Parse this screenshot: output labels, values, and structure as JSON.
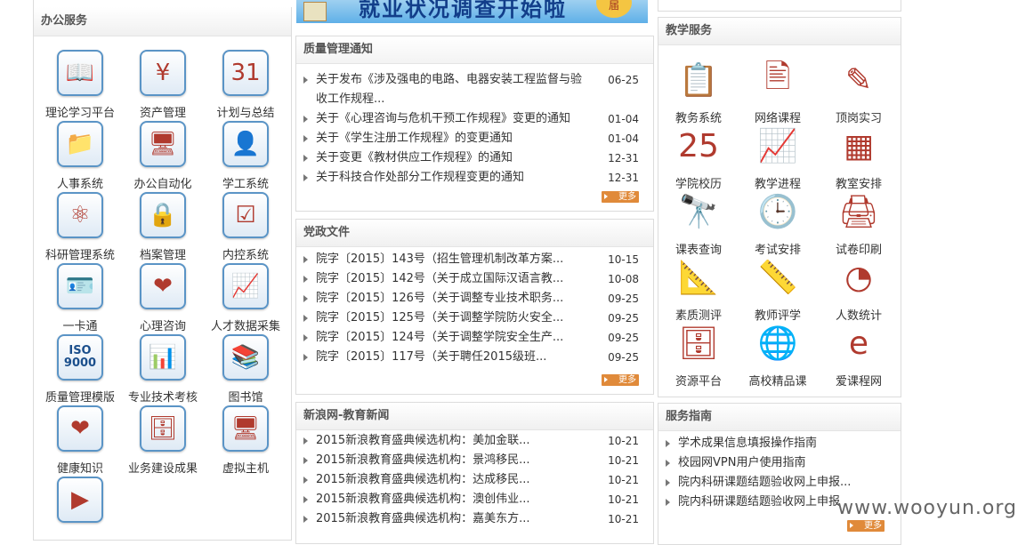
{
  "banner": {
    "text": "就业状况调查开始啦",
    "badge": "届"
  },
  "office": {
    "title": "办公服务",
    "items": [
      {
        "label": "理论学习平台",
        "icon": "book-icon",
        "glyph": "📖"
      },
      {
        "label": "资产管理",
        "icon": "coin-icon",
        "glyph": "¥"
      },
      {
        "label": "计划与总结",
        "icon": "calendar-icon",
        "glyph": "31"
      },
      {
        "label": "人事系统",
        "icon": "folder-icon",
        "glyph": "📁"
      },
      {
        "label": "办公自动化",
        "icon": "network-icon",
        "glyph": "🖥"
      },
      {
        "label": "学工系统",
        "icon": "student-icon",
        "glyph": "👤"
      },
      {
        "label": "科研管理系统",
        "icon": "atom-icon",
        "glyph": "⚛"
      },
      {
        "label": "档案管理",
        "icon": "lock-icon",
        "glyph": "🔒"
      },
      {
        "label": "内控系统",
        "icon": "checklist-icon",
        "glyph": "☑"
      },
      {
        "label": "一卡通",
        "icon": "id-card-icon",
        "glyph": "🪪"
      },
      {
        "label": "心理咨询",
        "icon": "heart-book-icon",
        "glyph": "❤"
      },
      {
        "label": "人才数据采集",
        "icon": "chart-up-icon",
        "glyph": "📈"
      },
      {
        "label": "质量管理模版",
        "icon": "iso-icon",
        "glyph": "ISO 9000"
      },
      {
        "label": "专业技术考核",
        "icon": "presenter-icon",
        "glyph": "📊"
      },
      {
        "label": "图书馆",
        "icon": "books-icon",
        "glyph": "📚"
      },
      {
        "label": "健康知识",
        "icon": "health-icon",
        "glyph": "❤"
      },
      {
        "label": "业务建设成果",
        "icon": "cabinet-icon",
        "glyph": "🗄"
      },
      {
        "label": "虚拟主机",
        "icon": "monitor-icon",
        "glyph": "🖥"
      },
      {
        "label": "",
        "icon": "media-player-icon",
        "glyph": "▶"
      }
    ]
  },
  "quality": {
    "title": "质量管理通知",
    "items": [
      {
        "title": "关于发布《涉及强电的电路、电器安装工程监督与验收工作规程...",
        "date": "06-25",
        "wrap": true
      },
      {
        "title": "关于《心理咨询与危机干预工作规程》变更的通知",
        "date": "01-04"
      },
      {
        "title": "关于《学生注册工作规程》的变更通知",
        "date": "01-04"
      },
      {
        "title": "关于变更《教材供应工作规程》的通知",
        "date": "12-31"
      },
      {
        "title": "关于科技合作处部分工作规程变更的通知",
        "date": "12-31"
      }
    ],
    "more": "更多"
  },
  "party": {
    "title": "党政文件",
    "items": [
      {
        "title": "院字〔2015〕143号（招生管理机制改革方案...",
        "date": "10-15"
      },
      {
        "title": "院字〔2015〕142号（关于成立国际汉语言教...",
        "date": "10-08"
      },
      {
        "title": "院字〔2015〕126号（关于调整专业技术职务...",
        "date": "09-25"
      },
      {
        "title": "院字〔2015〕125号（关于调整学院防火安全...",
        "date": "09-25"
      },
      {
        "title": "院字〔2015〕124号（关于调整学院安全生产...",
        "date": "09-25"
      },
      {
        "title": "院字〔2015〕117号（关于聘任2015级班...",
        "date": "09-25"
      }
    ],
    "more": "更多"
  },
  "sina": {
    "title": "新浪网-教育新闻",
    "items": [
      {
        "title": "2015新浪教育盛典候选机构：美加金联...",
        "date": "10-21"
      },
      {
        "title": "2015新浪教育盛典候选机构：景鸿移民...",
        "date": "10-21"
      },
      {
        "title": "2015新浪教育盛典候选机构：达成移民...",
        "date": "10-21"
      },
      {
        "title": "2015新浪教育盛典候选机构：澳创伟业...",
        "date": "10-21"
      },
      {
        "title": "2015新浪教育盛典候选机构：嘉美东方...",
        "date": "10-21"
      }
    ]
  },
  "teaching": {
    "title": "教学服务",
    "items": [
      {
        "label": "教务系统",
        "icon": "blackboard-icon",
        "glyph": "📋"
      },
      {
        "label": "网络课程",
        "icon": "web-page-icon",
        "glyph": "🖹"
      },
      {
        "label": "顶岗实习",
        "icon": "tools-icon",
        "glyph": "✎"
      },
      {
        "label": "学院校历",
        "icon": "calendar-25-icon",
        "glyph": "25"
      },
      {
        "label": "教学进程",
        "icon": "progress-chart-icon",
        "glyph": "📈"
      },
      {
        "label": "教室安排",
        "icon": "grid-calendar-icon",
        "glyph": "▦"
      },
      {
        "label": "课表查询",
        "icon": "binoculars-icon",
        "glyph": "🔭"
      },
      {
        "label": "考试安排",
        "icon": "clock-icon",
        "glyph": "🕒"
      },
      {
        "label": "试卷印刷",
        "icon": "printer-icon",
        "glyph": "🖨"
      },
      {
        "label": "素质测评",
        "icon": "triangle-ruler-icon",
        "glyph": "📐"
      },
      {
        "label": "教师评学",
        "icon": "ruler-icon",
        "glyph": "📏"
      },
      {
        "label": "人数统计",
        "icon": "pie-chart-icon",
        "glyph": "◔"
      },
      {
        "label": "资源平台",
        "icon": "server-icon",
        "glyph": "🗄"
      },
      {
        "label": "高校精品课",
        "icon": "globe-icon",
        "glyph": "🌐"
      },
      {
        "label": "爱课程网",
        "icon": "ike-logo-icon",
        "glyph": "e"
      }
    ]
  },
  "guide": {
    "title": "服务指南",
    "items": [
      {
        "title": "学术成果信息填报操作指南"
      },
      {
        "title": "校园网VPN用户使用指南"
      },
      {
        "title": "院内科研课题结题验收网上申报..."
      },
      {
        "title": "院内科研课题结题验收网上申报"
      }
    ],
    "more": "更多"
  },
  "watermark": "www.wooyun.org"
}
